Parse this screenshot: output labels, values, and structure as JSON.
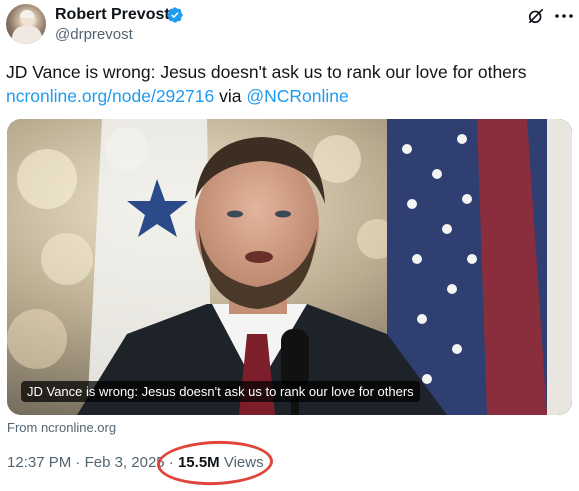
{
  "author": {
    "name": "Robert Prevost",
    "handle": "@drprevost",
    "verified": true
  },
  "tweet": {
    "text": "JD Vance is wrong: Jesus doesn't ask us to rank our love for others",
    "link": "ncronline.org/node/292716",
    "via": "via",
    "mention": "@NCRonline"
  },
  "card": {
    "caption": "JD Vance is wrong: Jesus doesn't ask us to rank our love for others",
    "source": "From ncronline.org"
  },
  "meta": {
    "time": "12:37 PM",
    "separator": "·",
    "date": "Feb 3, 2025",
    "views_count": "15.5M",
    "views_label": "Views"
  },
  "icons": {
    "verified": "verified-badge-icon",
    "grok": "grok-icon",
    "more": "more-options-icon"
  },
  "colors": {
    "link": "#1d9bf0",
    "secondary_text": "#536471",
    "highlight_circle": "#e0443a"
  }
}
